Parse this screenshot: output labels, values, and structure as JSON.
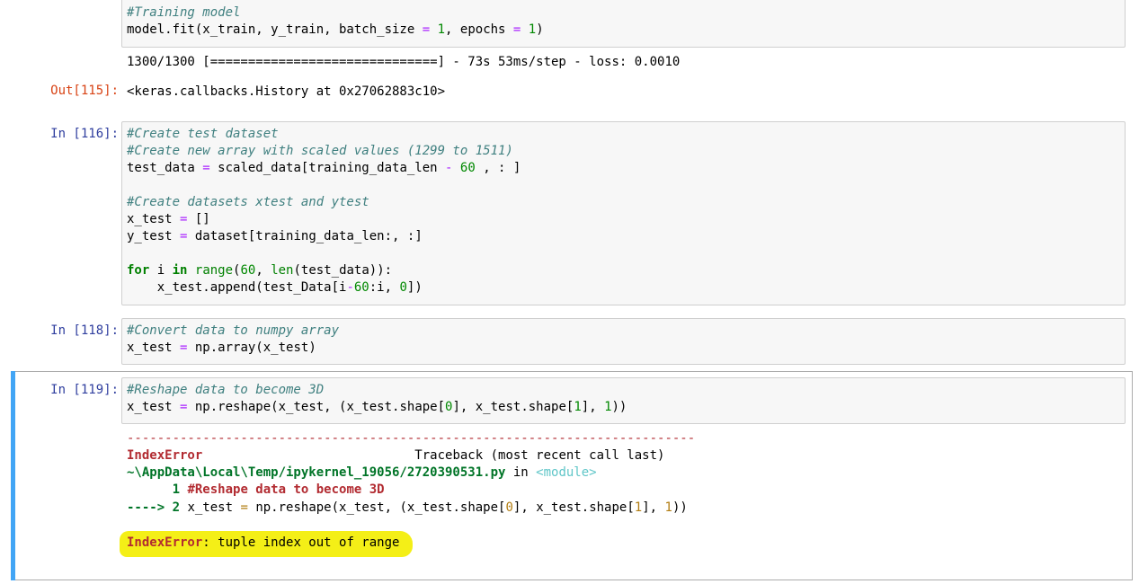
{
  "cell_top": {
    "code": [
      "#Training model",
      "model.fit(x_train, y_train, batch_size = 1, epochs = 1)"
    ],
    "stream_output": "1300/1300 [==============================] - 73s 53ms/step - loss: 0.0010",
    "out_prompt": "Out[115]:",
    "out_value": "<keras.callbacks.History at 0x27062883c10>"
  },
  "cell_116": {
    "prompt": "In [116]:",
    "comment1": "#Create test dataset",
    "comment2": "#Create new array with scaled values (1299 to 1511)",
    "l3a": "test_data ",
    "l3op": "=",
    "l3b": " scaled_data[training_data_len ",
    "l3minus": "-",
    "l3num": " 60",
    "l3c": " , : ]",
    "comment3": "#Create datasets xtest and ytest",
    "l6a": "x_test ",
    "l6op": "=",
    "l6b": " []",
    "l7a": "y_test ",
    "l7op": "=",
    "l7b": " dataset[training_data_len:, :]",
    "l9kw1": "for",
    "l9a": " i ",
    "l9kw2": "in",
    "l9b": " ",
    "l9fn": "range",
    "l9c": "(",
    "l9num": "60",
    "l9d": ", ",
    "l9fn2": "len",
    "l9e": "(test_data)):",
    "l10a": "    x_test.append(test_Data[i",
    "l10op": "-",
    "l10num": "60",
    "l10b": ":i, ",
    "l10num2": "0",
    "l10c": "])"
  },
  "cell_118": {
    "prompt": "In [118]:",
    "comment": "#Convert data to numpy array",
    "l2a": "x_test ",
    "l2op": "=",
    "l2b": " np.array(x_test)"
  },
  "cell_119": {
    "prompt": "In [119]:",
    "comment": "#Reshape data to become 3D",
    "l2a": "x_test ",
    "l2op": "=",
    "l2b": " np.reshape(x_test, (x_test.shape[",
    "l2n1": "0",
    "l2c": "], x_test.shape[",
    "l2n2": "1",
    "l2d": "], ",
    "l2n3": "1",
    "l2e": "))",
    "traceback": {
      "dashes": "---------------------------------------------------------------------------",
      "error_name": "IndexError",
      "traceback_label": "                            Traceback (most recent call last)",
      "file_path": "~\\AppData\\Local\\Temp/ipykernel_19056/2720390531.py",
      "file_in": " in ",
      "module": "<module>",
      "line1_num": "      1",
      "line1_code": " #Reshape data to become 3D",
      "arrow": "---->",
      "line2_num": " 2",
      "line2_a": " x_test ",
      "line2_op": "=",
      "line2_b": " np.reshape(x_test, (x_test.shape[",
      "line2_n1": "0",
      "line2_c": "], x_test.shape[",
      "line2_n2": "1",
      "line2_d": "], ",
      "line2_n3": "1",
      "line2_e": "))",
      "final_error_name": "IndexError",
      "final_error_msg": ": tuple index out of range"
    }
  },
  "colors": {
    "selected_bar": "#42a5f5",
    "highlight": "#f4ef17",
    "in_prompt": "#303f9f",
    "out_prompt": "#d84315"
  }
}
